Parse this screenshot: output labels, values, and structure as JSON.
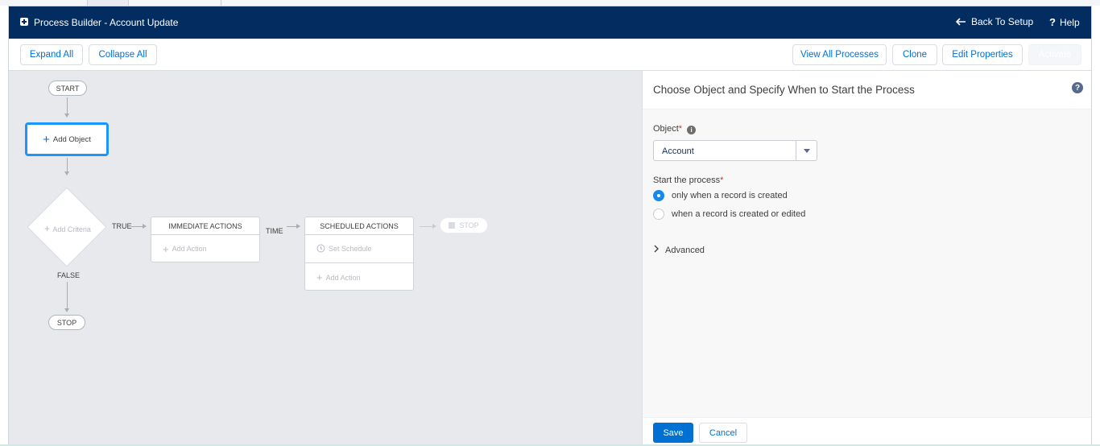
{
  "header": {
    "title": "Process Builder - Account Update",
    "back_label": "Back To Setup",
    "help_label": "Help"
  },
  "toolbar": {
    "expand_all": "Expand All",
    "collapse_all": "Collapse All",
    "view_all_processes": "View All Processes",
    "clone": "Clone",
    "edit_properties": "Edit Properties",
    "activate": "Activate"
  },
  "canvas": {
    "start": "START",
    "add_object": "Add Object",
    "add_criteria": "Add Criteria",
    "true_label": "TRUE",
    "false_label": "FALSE",
    "time_label": "TIME",
    "stop_bottom": "STOP",
    "stop_right": "STOP",
    "immediate": {
      "title": "IMMEDIATE ACTIONS",
      "add_action": "Add Action"
    },
    "scheduled": {
      "title": "SCHEDULED ACTIONS",
      "set_schedule": "Set Schedule",
      "add_action": "Add Action"
    }
  },
  "panel": {
    "title": "Choose Object and Specify When to Start the Process",
    "object_label": "Object",
    "object_value": "Account",
    "start_label": "Start the process",
    "options": [
      "only when a record is created",
      "when a record is created or edited"
    ],
    "advanced": "Advanced",
    "save": "Save",
    "cancel": "Cancel"
  },
  "colors": {
    "header_bg": "#032d60",
    "brand": "#0070d2",
    "focus": "#1b96ff"
  }
}
